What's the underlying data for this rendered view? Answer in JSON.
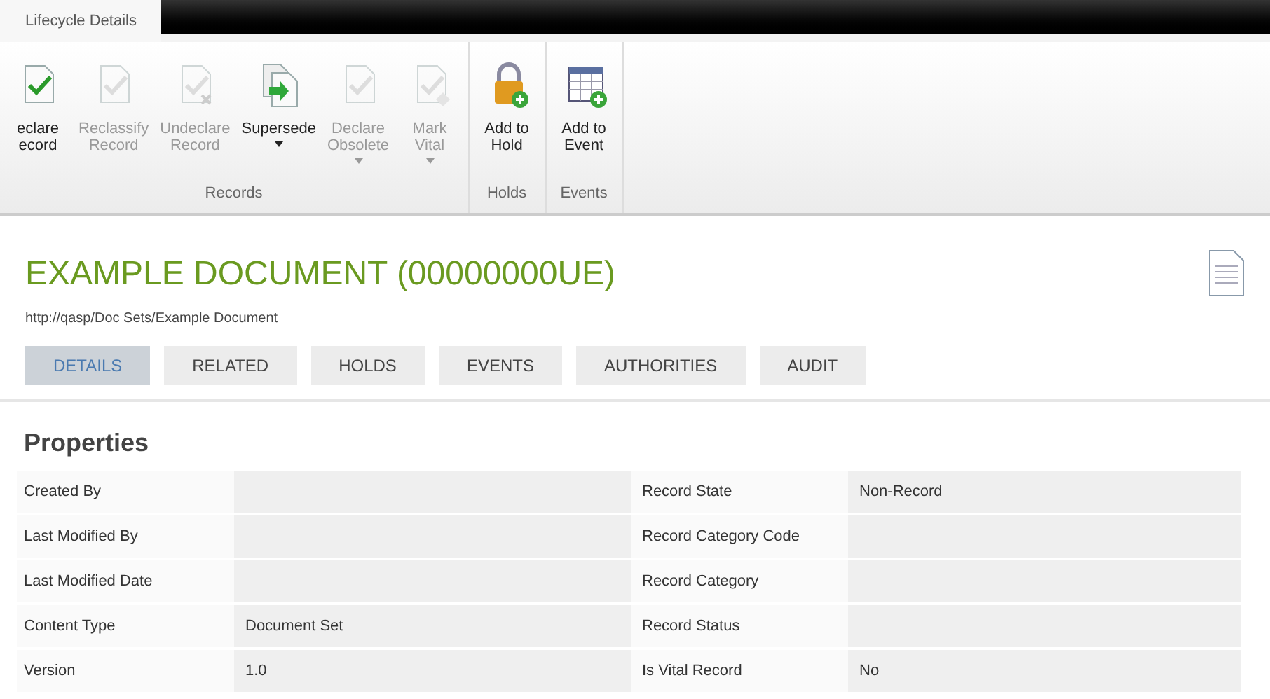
{
  "ribbon_tab": {
    "label": "Lifecycle Details"
  },
  "groups": [
    {
      "label": "Records",
      "buttons": [
        {
          "lines": [
            "eclare",
            "ecord"
          ],
          "kind": "declare",
          "disabled": false,
          "dropdown": false
        },
        {
          "lines": [
            "Reclassify",
            "Record"
          ],
          "kind": "reclassify",
          "disabled": true,
          "dropdown": false
        },
        {
          "lines": [
            "Undeclare",
            "Record"
          ],
          "kind": "undeclare",
          "disabled": true,
          "dropdown": false
        },
        {
          "lines": [
            "Supersede"
          ],
          "kind": "supersede",
          "disabled": false,
          "dropdown": true
        },
        {
          "lines": [
            "Declare",
            "Obsolete"
          ],
          "kind": "obsolete",
          "disabled": true,
          "dropdown": true
        },
        {
          "lines": [
            "Mark",
            "Vital"
          ],
          "kind": "vital",
          "disabled": true,
          "dropdown": true
        }
      ]
    },
    {
      "label": "Holds",
      "buttons": [
        {
          "lines": [
            "Add to",
            "Hold"
          ],
          "kind": "hold",
          "disabled": false,
          "dropdown": false
        }
      ]
    },
    {
      "label": "Events",
      "buttons": [
        {
          "lines": [
            "Add to",
            "Event"
          ],
          "kind": "event",
          "disabled": false,
          "dropdown": false
        }
      ]
    }
  ],
  "document": {
    "title": "EXAMPLE DOCUMENT (00000000UE)",
    "url": "http://qasp/Doc Sets/Example Document"
  },
  "tabs": [
    {
      "label": "DETAILS",
      "selected": true
    },
    {
      "label": "RELATED",
      "selected": false
    },
    {
      "label": "HOLDS",
      "selected": false
    },
    {
      "label": "EVENTS",
      "selected": false
    },
    {
      "label": "AUTHORITIES",
      "selected": false
    },
    {
      "label": "AUDIT",
      "selected": false
    }
  ],
  "properties": {
    "title": "Properties",
    "rows": [
      {
        "label": "Created By",
        "value": null,
        "label_2": "Record State",
        "value_2": "Non-Record"
      },
      {
        "label": "Last Modified By",
        "value": null,
        "label_2": "Record Category Code",
        "value_2": null
      },
      {
        "label": "Last Modified Date",
        "value": null,
        "label_2": "Record Category",
        "value_2": null
      },
      {
        "label": "Content Type",
        "value": "Document Set",
        "label_2": "Record Status",
        "value_2": null
      },
      {
        "label": "Version",
        "value": "1.0",
        "label_2": "Is Vital Record",
        "value_2": "No"
      }
    ]
  }
}
